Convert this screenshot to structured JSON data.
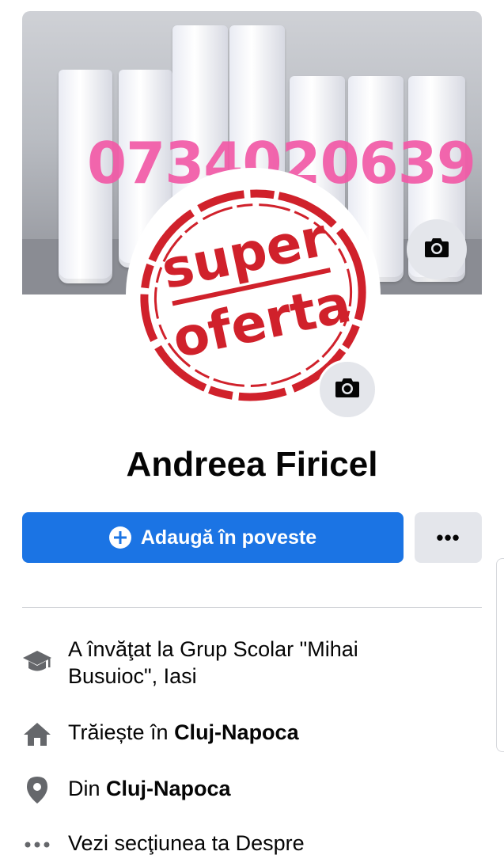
{
  "cover": {
    "phone_text": "0734020639"
  },
  "avatar": {
    "stamp_line1": "super",
    "stamp_line2": "oferta"
  },
  "profile": {
    "name": "Andreea Firicel"
  },
  "actions": {
    "add_story_label": "Adaugă în poveste",
    "more_label": "•••"
  },
  "intro": {
    "education_text": "A învăţat la Grup Scolar \"Mihai Busuioc\", Iasi",
    "lives_prefix": "Trăiește în ",
    "lives_city": "Cluj-Napoca",
    "from_prefix": "Din ",
    "from_city": "Cluj-Napoca",
    "about_link": "Vezi secţiunea ta Despre"
  },
  "icons": {
    "cover_camera": "camera-icon",
    "avatar_camera": "camera-icon",
    "education": "graduation-cap-icon",
    "home": "home-icon",
    "location": "location-pin-icon",
    "more": "more-dots-icon",
    "add": "plus-circle-icon"
  },
  "colors": {
    "primary": "#1b74e4",
    "stamp_red": "#d0212b",
    "phone_pink": "#f25aa7"
  }
}
